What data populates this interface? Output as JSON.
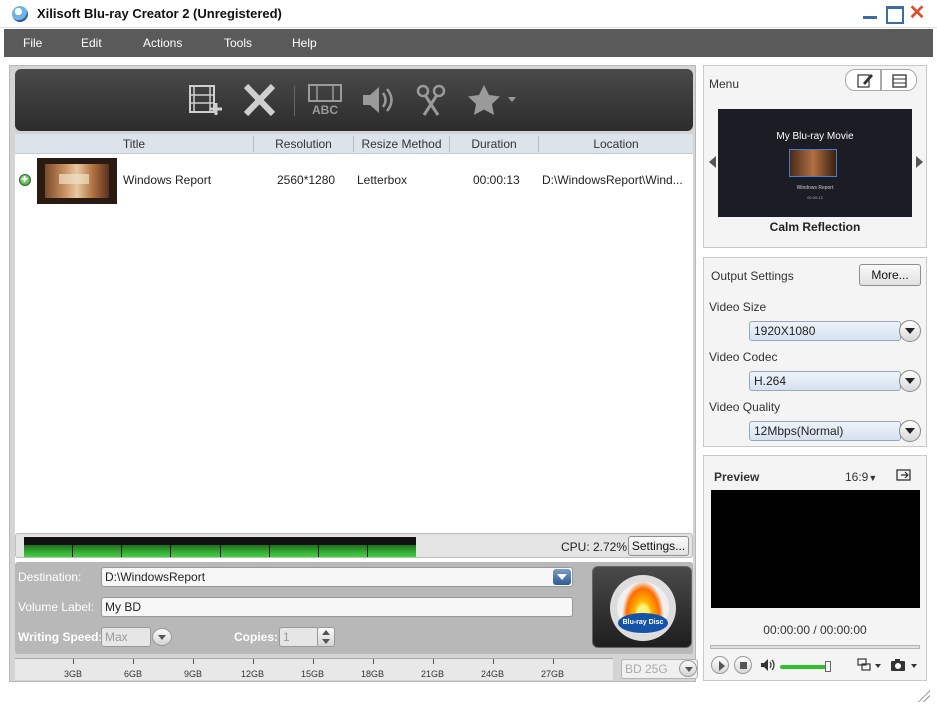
{
  "window": {
    "title": "Xilisoft Blu-ray Creator 2 (Unregistered)"
  },
  "menu": [
    {
      "label": "File"
    },
    {
      "label": "Edit"
    },
    {
      "label": "Actions"
    },
    {
      "label": "Tools"
    },
    {
      "label": "Help"
    }
  ],
  "file_list": {
    "columns": [
      "Title",
      "Resolution",
      "Resize Method",
      "Duration",
      "Location"
    ],
    "rows": [
      {
        "title": "Windows Report",
        "resolution": "2560*1280",
        "resize_method": "Letterbox",
        "duration": "00:00:13",
        "location": "D:\\WindowsReport\\Wind..."
      }
    ]
  },
  "cpu": {
    "text": "CPU: 2.72%",
    "settings_label": "Settings..."
  },
  "destination": {
    "label": "Destination:",
    "value": "D:\\WindowsReport",
    "volume_label": "Volume Label:",
    "volume_value": "My BD",
    "writing_speed_label": "Writing Speed:",
    "writing_speed_value": "Max",
    "copies_label": "Copies:",
    "copies_value": "1"
  },
  "capacity": {
    "ticks": [
      "3GB",
      "6GB",
      "9GB",
      "12GB",
      "15GB",
      "18GB",
      "21GB",
      "24GB",
      "27GB"
    ],
    "disc_type": "BD 25G"
  },
  "menu_panel": {
    "title": "Menu",
    "preview_title": "My Blu-ray Movie",
    "preview_subtitle": "Windows Report",
    "preview_duration": "00:00:13",
    "theme_name": "Calm Reflection"
  },
  "output_settings": {
    "title": "Output Settings",
    "more_label": "More...",
    "video_size_label": "Video Size",
    "video_size": "1920X1080",
    "video_codec_label": "Video Codec",
    "video_codec": "H.264",
    "video_quality_label": "Video Quality",
    "video_quality": "12Mbps(Normal)"
  },
  "preview": {
    "title": "Preview",
    "aspect": "16:9",
    "time": "00:00:00 / 00:00:00",
    "volume_level": 0.92
  },
  "colors": {
    "menubar": "#5a5a5a",
    "toolbar": "#2c2c2c",
    "meter_green": "#37b637",
    "accent_blue": "#2e5a8e"
  }
}
